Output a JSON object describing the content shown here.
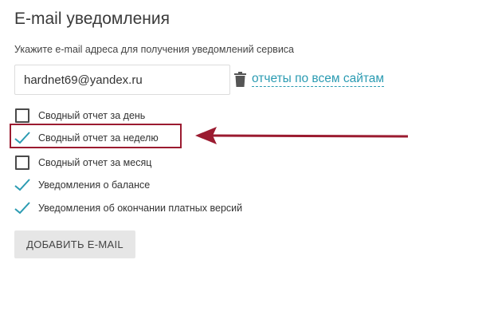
{
  "section": {
    "title": "E-mail уведомления",
    "subtitle": "Укажите e-mail адреса для получения уведомлений сервиса"
  },
  "email": {
    "value": "hardnet69@yandex.ru",
    "delete_icon": "trash-icon",
    "sites_link": "отчеты по всем сайтам"
  },
  "options": [
    {
      "label": "Сводный отчет за день",
      "checked": false
    },
    {
      "label": "Сводный отчет за неделю",
      "checked": true
    },
    {
      "label": "Сводный отчет за месяц",
      "checked": false
    },
    {
      "label": "Уведомления о балансе",
      "checked": true
    },
    {
      "label": "Уведомления об окончании платных версий",
      "checked": true
    }
  ],
  "add_button": "ДОБАВИТЬ E-MAIL",
  "colors": {
    "accent": "#2b9bb2",
    "highlight": "#9b1b30",
    "button_bg": "#e6e6e6"
  }
}
